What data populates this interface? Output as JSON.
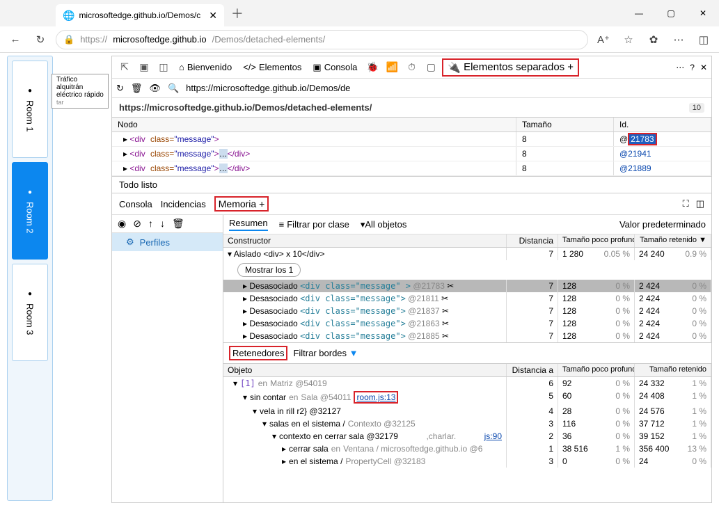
{
  "tab_title": "microsoftedge.github.io/Demos/c",
  "url_host": "microsoftedge.github.io",
  "url_path": "/Demos/detached-elements/",
  "url_prefix": "https://",
  "tooltip": "Tráfico alquitrán eléctrico rápido",
  "tooltip2": "tar",
  "rooms": [
    "Room 1",
    "Room 2",
    "Room 3"
  ],
  "dt_tabs": {
    "bienvenido": "Bienvenido",
    "elementos": "Elementos",
    "consola": "Consola",
    "detached": "Elementos separados",
    "plus": "+"
  },
  "sub_url": "https://microsoftedge.github.io/Demos/de",
  "section_url": "https://microsoftedge.github.io/Demos/detached-elements/",
  "section_badge": "10",
  "cols": {
    "node": "Nodo",
    "size": "Tamaño",
    "id": "Id."
  },
  "rows": [
    {
      "html": "<div class=\" message\"&gt;",
      "size": "8",
      "id": "@21783",
      "hl": true
    },
    {
      "html": "<div class=\"message\">…</div>",
      "size": "8",
      "id": "@21941"
    },
    {
      "html": "<div class=\"message\">…</div>",
      "size": "8",
      "id": "@21889"
    }
  ],
  "status": "Todo listo",
  "mem": {
    "consola": "Consola",
    "incidencias": "Incidencias",
    "memoria": "Memoria",
    "plus": "+"
  },
  "profiles": "Perfiles",
  "toolbar": {
    "resumen": "Resumen",
    "filtrar": "Filtrar por clase",
    "all": "All objetos",
    "valor": "Valor predeterminado"
  },
  "mcols": {
    "constructor": "Constructor",
    "dist": "Distancia",
    "shallow": "Tamaño poco profundo",
    "retained": "Tamaño retenido"
  },
  "isolated": "Aislado <div> x 10</div>",
  "show": "Mostrar los 1",
  "detached_label": "Desasociado",
  "drows": [
    {
      "tag": "<div class=\"message\"    >",
      "id": "@21783",
      "d": "7",
      "s": "128",
      "sp": "0 %",
      "r": "2 424",
      "rp": "0 %",
      "sel": true
    },
    {
      "tag": "<div class=\"message\">",
      "id": "@21811",
      "d": "7",
      "s": "128",
      "sp": "0 %",
      "r": "2 424",
      "rp": "0 %"
    },
    {
      "tag": "<div class=\"message\">",
      "id": "@21837",
      "d": "7",
      "s": "128",
      "sp": "0 %",
      "r": "2 424",
      "rp": "0 %"
    },
    {
      "tag": "<div class=\"message\">",
      "id": "@21863",
      "d": "7",
      "s": "128",
      "sp": "0 %",
      "r": "2 424",
      "rp": "0 %"
    },
    {
      "tag": "<div class=\"message\">",
      "id": "@21885",
      "d": "7",
      "s": "128",
      "sp": "0 %",
      "r": "2 424",
      "rp": "0 %"
    }
  ],
  "isol": {
    "d": "7",
    "s": "1 280",
    "sp": "0.05 %",
    "r": "24 240",
    "rp": "0.9 %"
  },
  "ret": {
    "label": "Retenedores",
    "filter": "Filtrar bordes"
  },
  "rcols": {
    "obj": "Objeto",
    "dist": "Distancia a",
    "shallow": "Tamaño poco profundo",
    "retained": "Tamaño retenido"
  },
  "rrows": [
    {
      "l": 0,
      "pre": "[1]",
      "mid": "en",
      "obj": "Matriz @54019",
      "d": "6",
      "s": "92",
      "sp": "0 %",
      "r": "24 332",
      "rp": "1 %"
    },
    {
      "l": 1,
      "pre": "sin contar",
      "mid": "en",
      "obj": "Sala @54011",
      "link": "room.js:13",
      "hl": true,
      "d": "5",
      "s": "60",
      "sp": "0 %",
      "r": "24 408",
      "rp": "1 %"
    },
    {
      "l": 2,
      "pre": "vela in rill r2} @32127",
      "d": "4",
      "s": "28",
      "sp": "0 %",
      "r": "24 576",
      "rp": "1 %"
    },
    {
      "l": 3,
      "pre": "salas en el sistema /",
      "obj": "Contexto @32125",
      "d": "3",
      "s": "116",
      "sp": "0 %",
      "r": "37 712",
      "rp": "1 %"
    },
    {
      "l": 4,
      "pre": "contexto en cerrar sala @32179",
      "tail": ",charlar.",
      "link": "js:90",
      "d": "2",
      "s": "36",
      "sp": "0 %",
      "r": "39 152",
      "rp": "1 %"
    },
    {
      "l": 5,
      "pre": "cerrar sala",
      "mid": "en",
      "obj": "Ventana / microsoftedge.github.io @6",
      "d": "1",
      "s": "38 516",
      "sp": "1 %",
      "r": "356 400",
      "rp": "13 %"
    },
    {
      "l": 5,
      "pre": "en el sistema /",
      "obj": "PropertyCell @32183",
      "d": "3",
      "s": "0",
      "sp": "0 %",
      "r": "24",
      "rp": "0 %"
    }
  ]
}
